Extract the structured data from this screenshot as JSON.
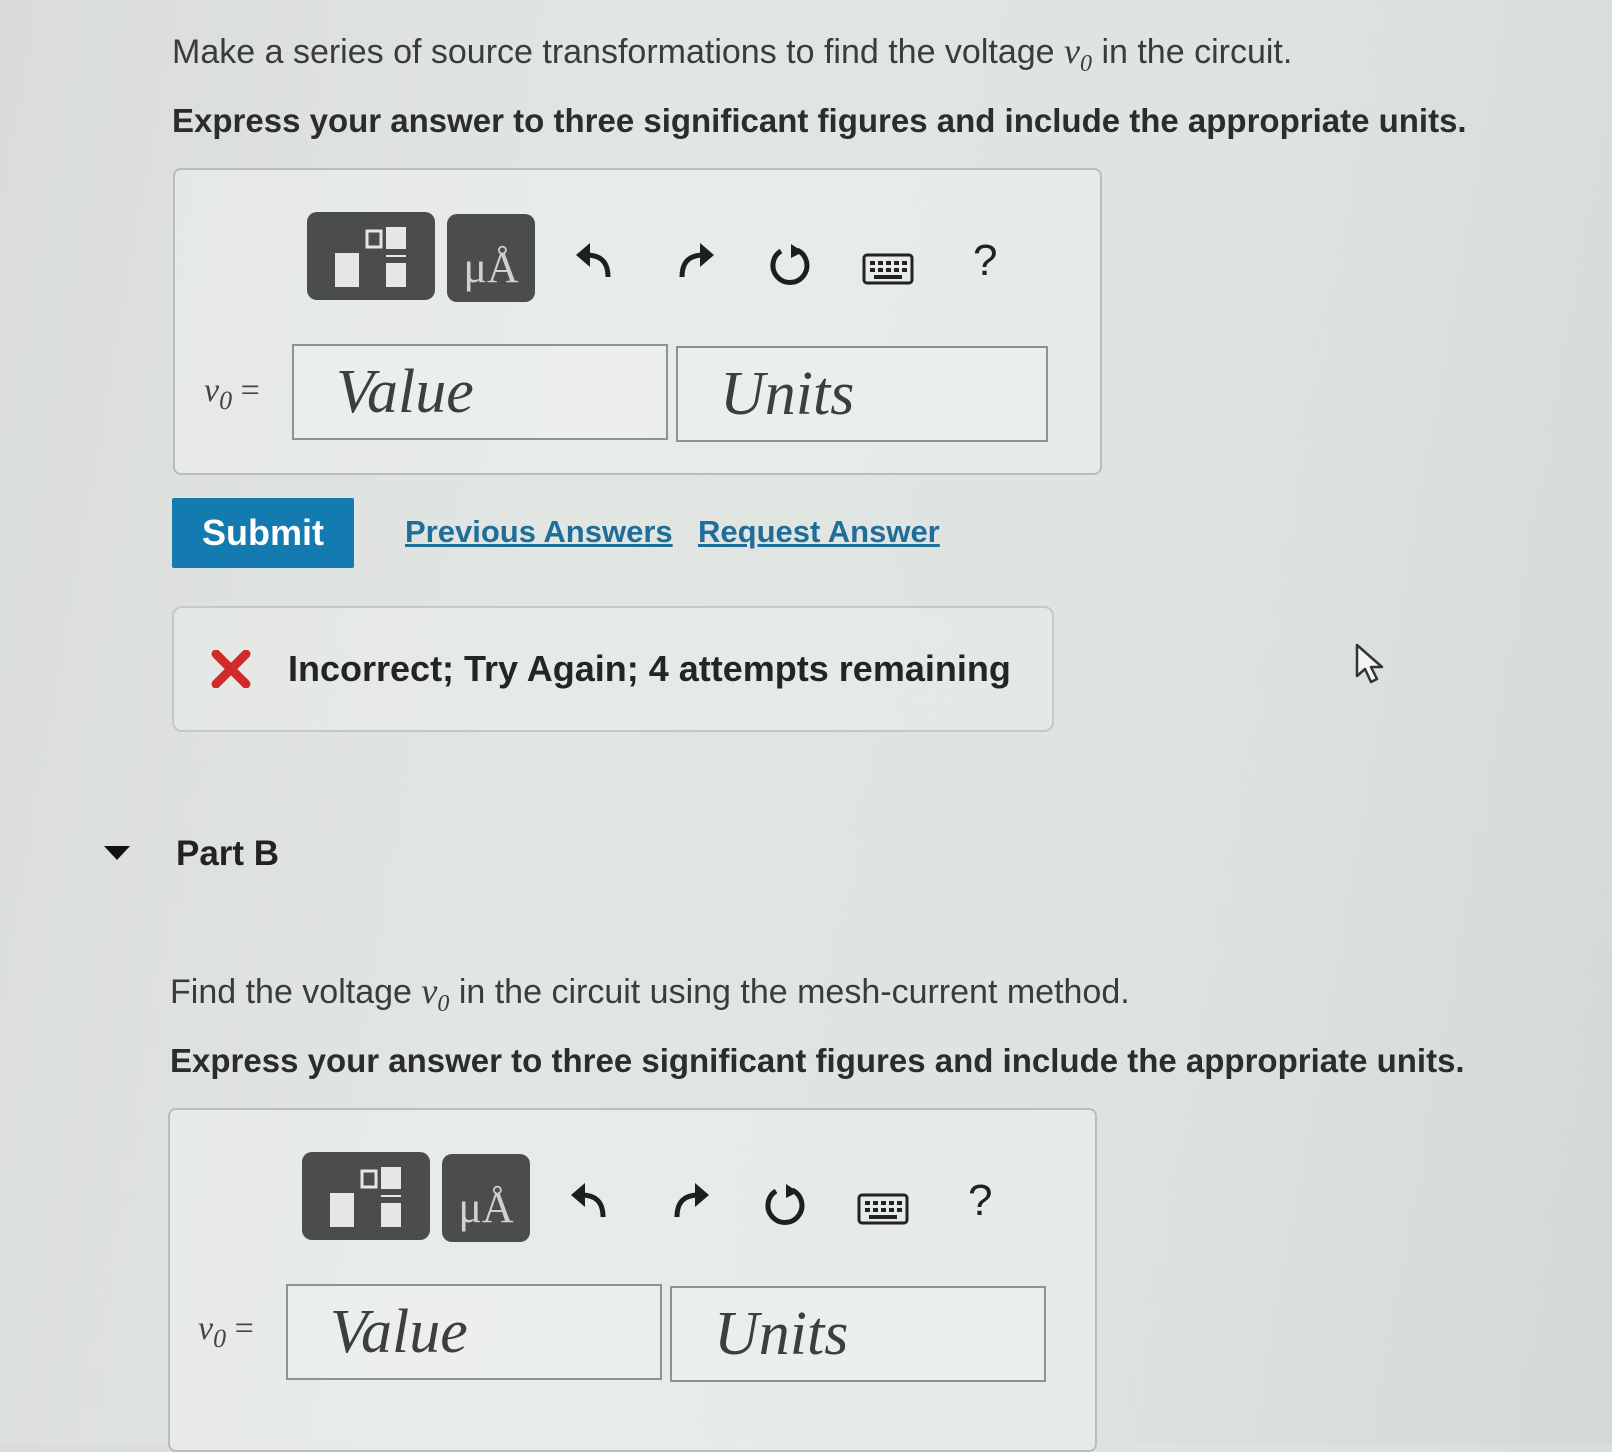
{
  "part_a": {
    "prompt_before": "Make a series of source transformations to find the voltage ",
    "prompt_var": "v",
    "prompt_sub": "0",
    "prompt_after": " in the circuit.",
    "instructions": "Express your answer to three significant figures and include the appropriate units.",
    "toolbar": {
      "units_button_label": "μÅ",
      "help_label": "?"
    },
    "answer": {
      "variable": "v",
      "subscript": "0",
      "equals": " =",
      "value_placeholder": "Value",
      "units_placeholder": "Units"
    },
    "actions": {
      "submit_label": "Submit",
      "previous_answers_label": "Previous Answers",
      "request_answer_label": "Request Answer"
    },
    "feedback": {
      "text": "Incorrect; Try Again; 4 attempts remaining",
      "status_color": "#d22a2a"
    }
  },
  "part_b": {
    "title": "Part B",
    "prompt_before": "Find the voltage ",
    "prompt_var": "v",
    "prompt_sub": "0",
    "prompt_after": " in the circuit using the mesh-current method.",
    "instructions": "Express your answer to three significant figures and include the appropriate units.",
    "toolbar": {
      "units_button_label": "μÅ",
      "help_label": "?"
    },
    "answer": {
      "variable": "v",
      "subscript": "0",
      "equals": " =",
      "value_placeholder": "Value",
      "units_placeholder": "Units"
    }
  },
  "colors": {
    "accent": "#137bb0",
    "link": "#1f6e9a",
    "error": "#d22a2a"
  }
}
